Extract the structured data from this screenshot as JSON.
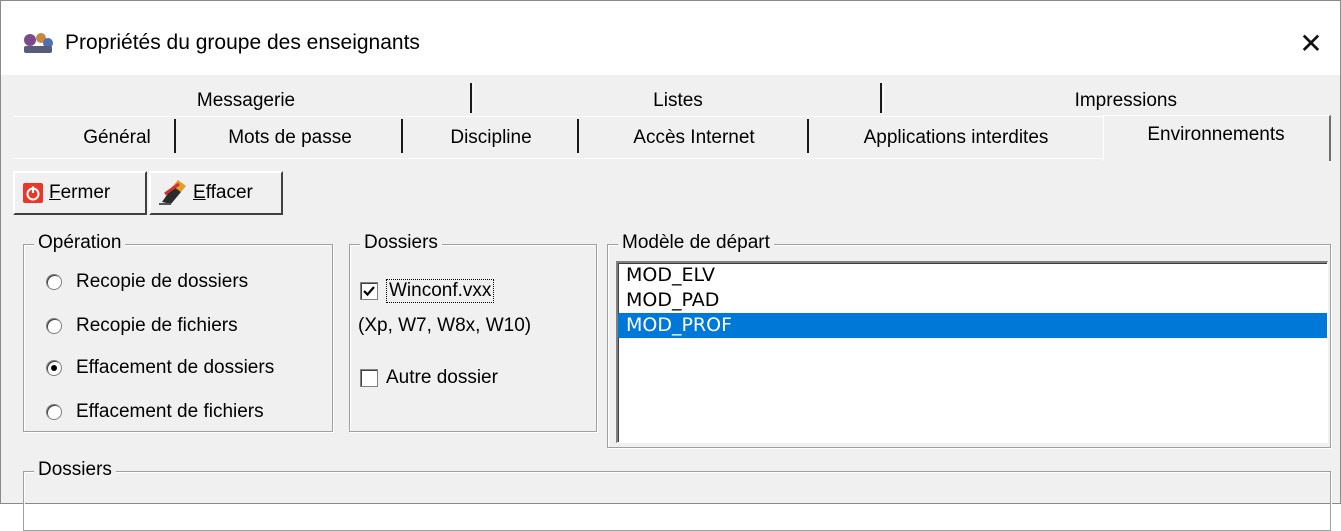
{
  "window": {
    "title": "Propriétés du groupe des enseignants",
    "close_glyph": "✕"
  },
  "tabs": {
    "row1": [
      "Messagerie",
      "Listes",
      "Impressions"
    ],
    "row2": [
      "Général",
      "Mots de passe",
      "Discipline",
      "Accès Internet",
      "Applications interdites",
      "Environnements"
    ],
    "active": "Environnements"
  },
  "toolbar": {
    "close_label": "Fermer",
    "clear_label": "Effacer",
    "close_icon": "power-icon",
    "clear_icon": "eraser-icon"
  },
  "operation": {
    "legend": "Opération",
    "options": [
      {
        "label": "Recopie de dossiers",
        "checked": false
      },
      {
        "label": "Recopie de fichiers",
        "checked": false
      },
      {
        "label": "Effacement de dossiers",
        "checked": true
      },
      {
        "label": "Effacement de fichiers",
        "checked": false
      }
    ]
  },
  "folders": {
    "legend": "Dossiers",
    "winconf_label": "Winconf.vxx",
    "winconf_checked": true,
    "winconf_note": "(Xp, W7, W8x, W10)",
    "other_label": "Autre dossier",
    "other_checked": false
  },
  "model": {
    "legend": "Modèle de départ",
    "items": [
      "MOD_ELV",
      "MOD_PAD",
      "MOD_PROF"
    ],
    "selected": "MOD_PROF"
  },
  "bottom": {
    "legend": "Dossiers"
  },
  "colors": {
    "selection": "#0078d7",
    "close_icon_bg": "#e8382a"
  }
}
